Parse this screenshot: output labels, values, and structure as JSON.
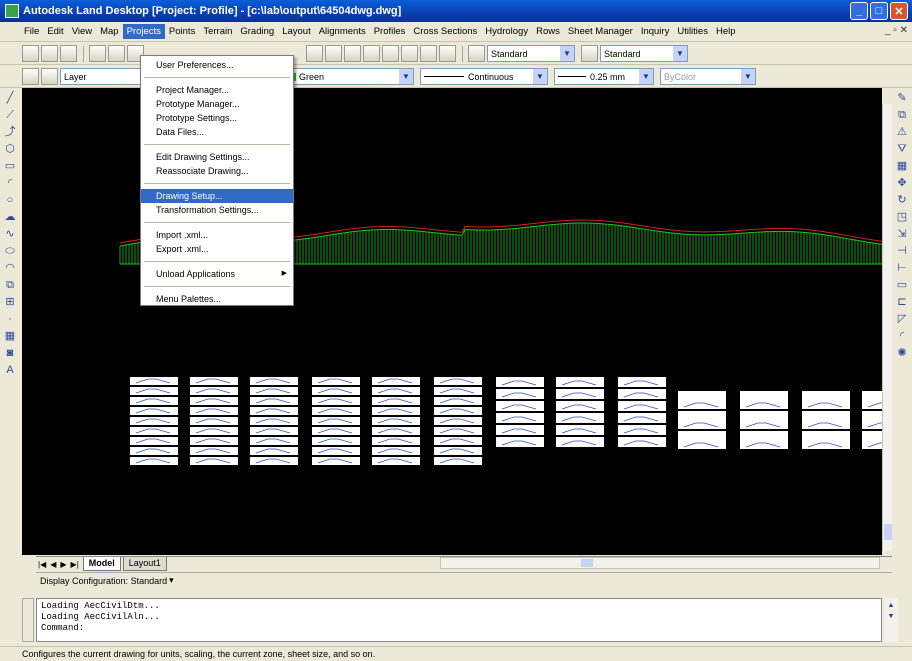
{
  "window": {
    "title": "Autodesk Land Desktop [Project: Profile] - [c:\\lab\\output\\64504dwg.dwg]",
    "controls": [
      "_",
      "□",
      "✕"
    ]
  },
  "menubar": {
    "items": [
      "File",
      "Edit",
      "View",
      "Map",
      "Projects",
      "Points",
      "Terrain",
      "Grading",
      "Layout",
      "Alignments",
      "Profiles",
      "Cross Sections",
      "Hydrology",
      "Rows",
      "Sheet Manager",
      "Inquiry",
      "Utilities",
      "Help"
    ],
    "active": "Projects",
    "mdi_controls": "_ ▫ ✕"
  },
  "toolbar": {
    "style_combo": "Standard",
    "dim_combo": "Standard",
    "layer_combo": "Layer",
    "color_combo": "Green",
    "linetype_combo": "Continuous",
    "lineweight_combo": "0.25 mm",
    "plotstyle_combo": "ByColor"
  },
  "projects_menu": {
    "items": [
      {
        "label": "User Preferences...",
        "group": 0
      },
      {
        "label": "Project Manager...",
        "group": 1
      },
      {
        "label": "Prototype Manager...",
        "group": 1
      },
      {
        "label": "Prototype Settings...",
        "group": 1
      },
      {
        "label": "Data Files...",
        "group": 1
      },
      {
        "label": "Edit Drawing Settings...",
        "group": 2
      },
      {
        "label": "Reassociate Drawing...",
        "group": 2
      },
      {
        "label": "Drawing Setup...",
        "group": 3,
        "highlighted": true
      },
      {
        "label": "Transformation Settings...",
        "group": 3
      },
      {
        "label": "Import .xml...",
        "group": 4
      },
      {
        "label": "Export .xml...",
        "group": 4
      },
      {
        "label": "Unload Applications",
        "group": 5,
        "submenu": true
      },
      {
        "label": "Menu Palettes...",
        "group": 6
      }
    ]
  },
  "layout_tabs": {
    "tabs": [
      "Model",
      "Layout1"
    ],
    "active": "Model"
  },
  "display_config": {
    "label": "Display Configuration:",
    "value": "Standard"
  },
  "command_window": {
    "lines": [
      "Loading AecCivilDtm...",
      "Loading AecCivilAln..."
    ],
    "prompt": "Command:"
  },
  "status_text": "Configures the current drawing for units, scaling, the current zone, sheet size, and so on.",
  "colors": {
    "titlebar": "#0a3fb0",
    "canvas": "#000000",
    "profile_green": "#18c818",
    "profile_red": "#d42020",
    "highlight": "#316ac5"
  }
}
